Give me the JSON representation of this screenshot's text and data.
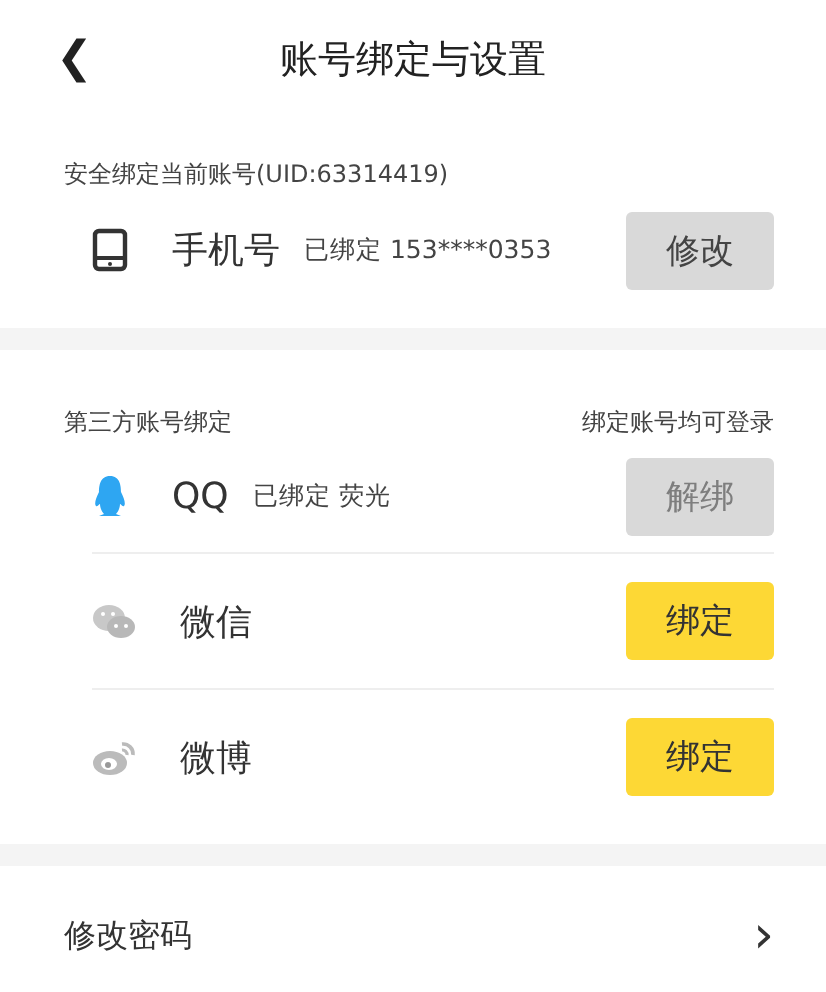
{
  "header": {
    "back_icon": "❮",
    "title": "账号绑定与设置"
  },
  "account": {
    "label": "安全绑定当前账号(UID:63314419)",
    "name": "手机号",
    "status": "已绑定 153****0353",
    "button": "修改"
  },
  "third_party": {
    "label": "第三方账号绑定",
    "hint": "绑定账号均可登录",
    "items": [
      {
        "kind": "qq",
        "name": "QQ",
        "status": "已绑定 荧光",
        "bound": true,
        "button": "解绑"
      },
      {
        "kind": "wechat",
        "name": "微信",
        "bound": false,
        "button": "绑定"
      },
      {
        "kind": "weibo",
        "name": "微博",
        "bound": false,
        "button": "绑定"
      }
    ]
  },
  "password": {
    "label": "修改密码",
    "chevron": "›"
  }
}
